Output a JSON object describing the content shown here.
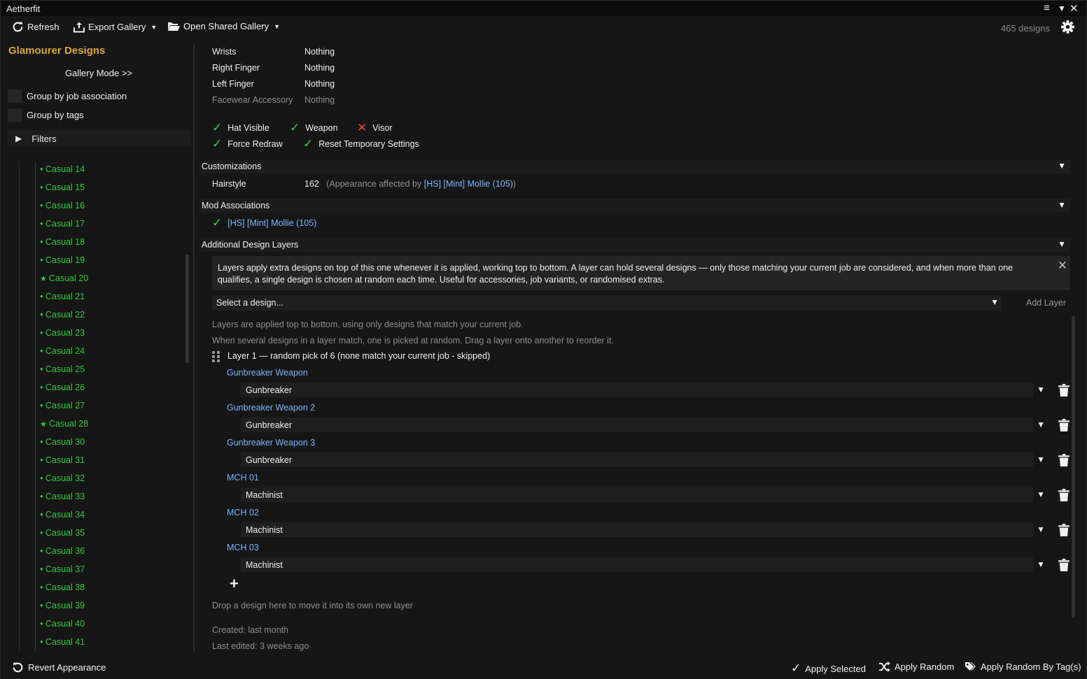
{
  "app": {
    "title": "Aetherfit"
  },
  "toolbar": {
    "refresh_label": "Refresh",
    "export_label": "Export Gallery",
    "open_shared_label": "Open Shared Gallery",
    "design_count": "465 designs"
  },
  "sidebar": {
    "heading": "Glamourer Designs",
    "gallery_mode": "Gallery Mode >>",
    "group_job": "Group by job association",
    "group_tags": "Group by tags",
    "filters": "Filters",
    "items": [
      {
        "label": "Casual 14",
        "marker": "bullet"
      },
      {
        "label": "Casual 15",
        "marker": "bullet"
      },
      {
        "label": "Casual 16",
        "marker": "bullet"
      },
      {
        "label": "Casual 17",
        "marker": "bullet"
      },
      {
        "label": "Casual 18",
        "marker": "bullet"
      },
      {
        "label": "Casual 19",
        "marker": "bullet"
      },
      {
        "label": "Casual 20",
        "marker": "star"
      },
      {
        "label": "Casual 21",
        "marker": "bullet"
      },
      {
        "label": "Casual 22",
        "marker": "bullet"
      },
      {
        "label": "Casual 23",
        "marker": "bullet"
      },
      {
        "label": "Casual 24",
        "marker": "bullet"
      },
      {
        "label": "Casual 25",
        "marker": "bullet"
      },
      {
        "label": "Casual 26",
        "marker": "bullet"
      },
      {
        "label": "Casual 27",
        "marker": "bullet"
      },
      {
        "label": "Casual 28",
        "marker": "star"
      },
      {
        "label": "Casual 30",
        "marker": "bullet"
      },
      {
        "label": "Casual 31",
        "marker": "bullet"
      },
      {
        "label": "Casual 32",
        "marker": "bullet"
      },
      {
        "label": "Casual 33",
        "marker": "bullet"
      },
      {
        "label": "Casual 34",
        "marker": "bullet"
      },
      {
        "label": "Casual 35",
        "marker": "bullet"
      },
      {
        "label": "Casual 36",
        "marker": "bullet"
      },
      {
        "label": "Casual 37",
        "marker": "bullet"
      },
      {
        "label": "Casual 38",
        "marker": "bullet"
      },
      {
        "label": "Casual 39",
        "marker": "bullet"
      },
      {
        "label": "Casual 40",
        "marker": "bullet"
      },
      {
        "label": "Casual 41",
        "marker": "bullet"
      }
    ]
  },
  "equipment": [
    {
      "slot": "Wrists",
      "value": "Nothing",
      "dim": false
    },
    {
      "slot": "Right Finger",
      "value": "Nothing",
      "dim": false
    },
    {
      "slot": "Left Finger",
      "value": "Nothing",
      "dim": false
    },
    {
      "slot": "Facewear Accessory",
      "value": "Nothing",
      "dim": true
    }
  ],
  "toggles": {
    "hat_visible": "Hat Visible",
    "weapon": "Weapon",
    "visor": "Visor",
    "force_redraw": "Force Redraw",
    "reset_temp": "Reset Temporary Settings"
  },
  "customizations": {
    "header": "Customizations",
    "hairstyle_label": "Hairstyle",
    "hairstyle_value": "162",
    "affected_prefix": "(Appearance affected by",
    "affected_mod": "[HS] [Mint] Mollie (105)",
    "affected_suffix": ")"
  },
  "mod_associations": {
    "header": "Mod Associations",
    "mod": "[HS] [Mint] Mollie (105)"
  },
  "layers": {
    "header": "Additional Design Layers",
    "info_line1": "Layers apply extra designs on top of this one whenever it is applied, working top to bottom. A layer can hold several designs — only those matching your current job are considered, and when more than one",
    "info_line2": "qualifies, a single design is chosen at random each time. Useful for accessories, job variants, or randomised extras.",
    "select_placeholder": "Select a design...",
    "add_layer": "Add Layer",
    "note1": "Layers are applied top to bottom, using only designs that match your current job.",
    "note2": "When several designs in a layer match, one is picked at random. Drag a layer onto another to reorder it.",
    "layer1_title": "Layer 1 — random pick of 6 (none match your current job - skipped)",
    "entries": [
      {
        "name": "Gunbreaker Weapon",
        "job": "Gunbreaker"
      },
      {
        "name": "Gunbreaker Weapon 2",
        "job": "Gunbreaker"
      },
      {
        "name": "Gunbreaker Weapon 3",
        "job": "Gunbreaker"
      },
      {
        "name": "MCH 01",
        "job": "Machinist"
      },
      {
        "name": "MCH 02",
        "job": "Machinist"
      },
      {
        "name": "MCH 03",
        "job": "Machinist"
      }
    ],
    "drop_hint": "Drop a design here to move it into its own new layer",
    "created": "Created: last month",
    "edited": "Last edited: 3 weeks ago"
  },
  "footer": {
    "revert": "Revert Appearance",
    "apply_selected": "Apply Selected",
    "apply_random": "Apply Random",
    "apply_random_tags": "Apply Random By Tag(s)"
  },
  "colors": {
    "accent_gold": "#d8a640",
    "tree_green": "#35c93b",
    "link_blue": "#79b5ff",
    "check_green": "#44c94b",
    "x_red": "#e64545"
  }
}
